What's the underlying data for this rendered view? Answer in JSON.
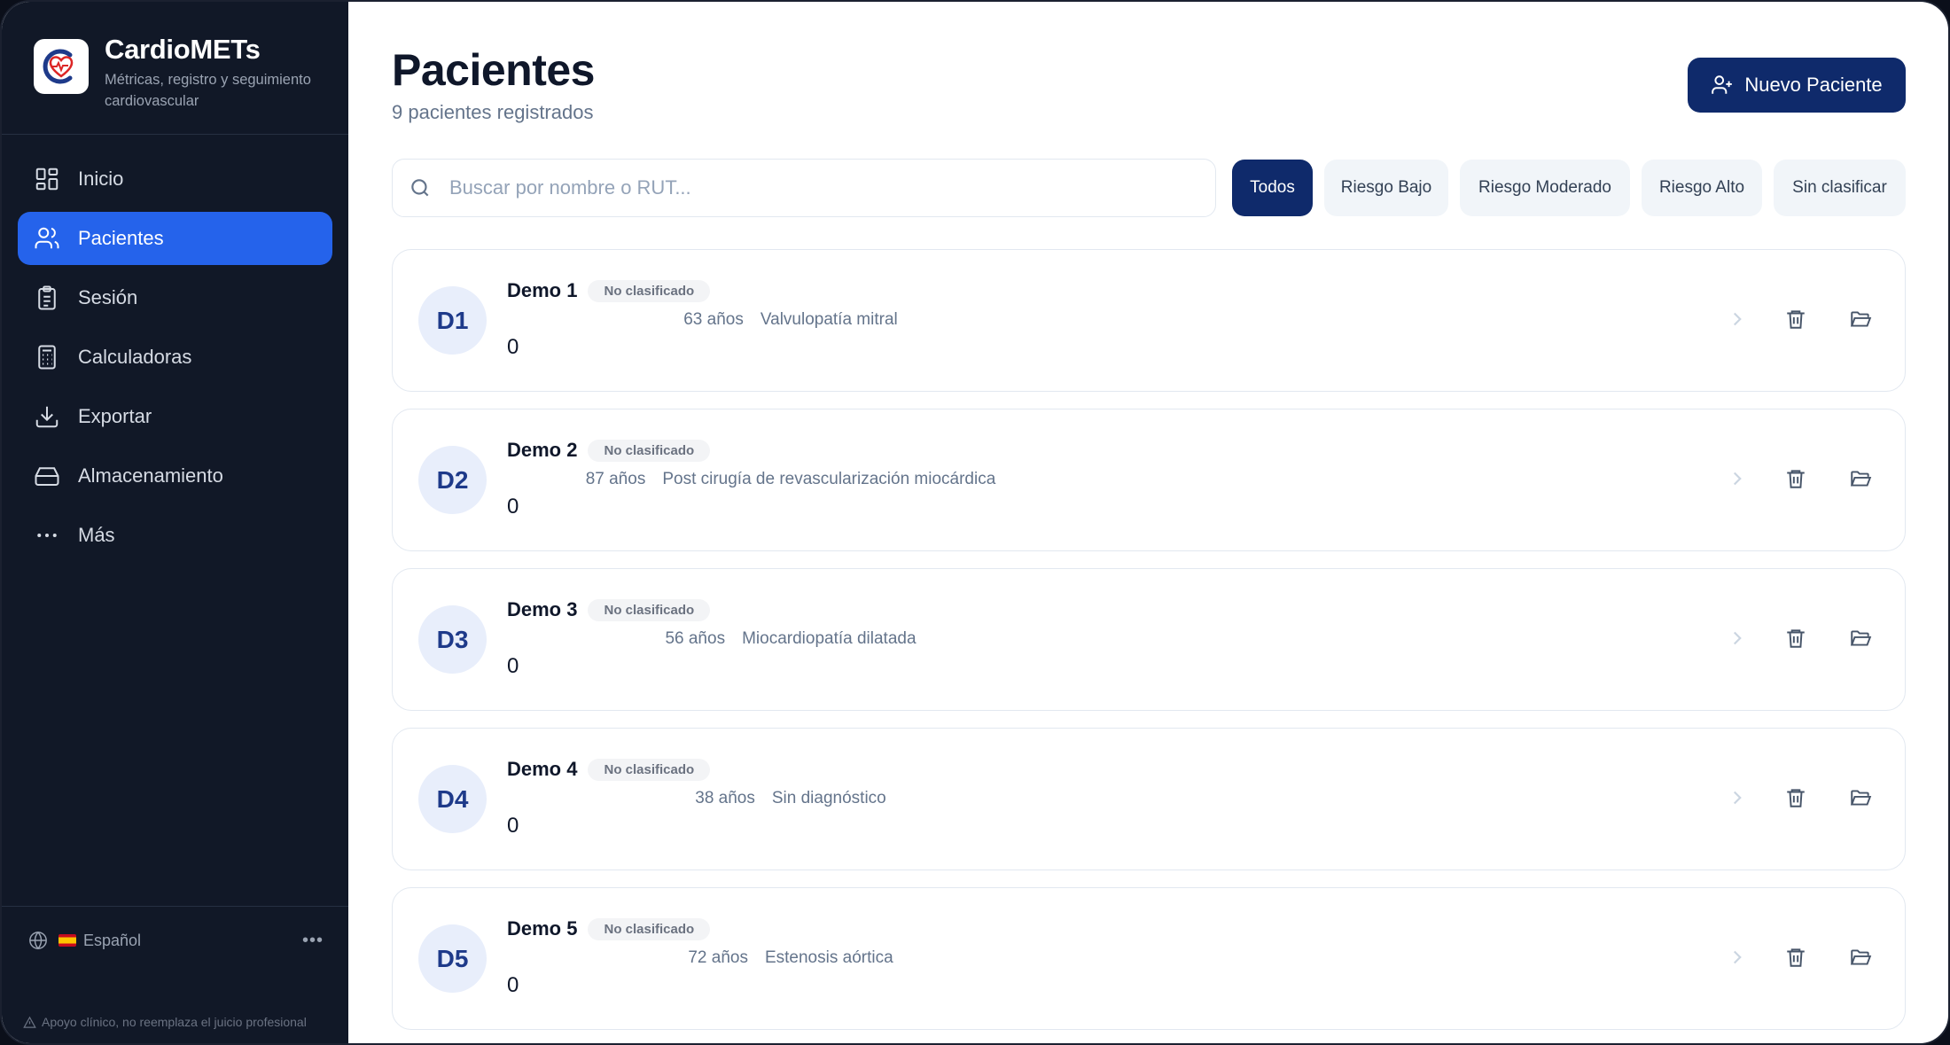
{
  "app": {
    "name": "CardioMETs",
    "tagline": "Métricas, registro y seguimiento cardiovascular"
  },
  "nav": [
    {
      "label": "Inicio",
      "icon": "grid-icon",
      "active": false
    },
    {
      "label": "Pacientes",
      "icon": "users-icon",
      "active": true
    },
    {
      "label": "Sesión",
      "icon": "clipboard-icon",
      "active": false
    },
    {
      "label": "Calculadoras",
      "icon": "calculator-icon",
      "active": false
    },
    {
      "label": "Exportar",
      "icon": "download-icon",
      "active": false
    },
    {
      "label": "Almacenamiento",
      "icon": "hard-drive-icon",
      "active": false
    },
    {
      "label": "Más",
      "icon": "more-horizontal-icon",
      "active": false
    }
  ],
  "footer": {
    "language": "Español",
    "disclaimer": "Apoyo clínico, no reemplaza el juicio profesional"
  },
  "page": {
    "title": "Pacientes",
    "subtitle": "9 pacientes registrados",
    "new_button": "Nuevo Paciente"
  },
  "search": {
    "placeholder": "Buscar por nombre o RUT...",
    "value": ""
  },
  "filters": [
    {
      "label": "Todos",
      "active": true
    },
    {
      "label": "Riesgo Bajo",
      "active": false
    },
    {
      "label": "Riesgo Moderado",
      "active": false
    },
    {
      "label": "Riesgo Alto",
      "active": false
    },
    {
      "label": "Sin clasificar",
      "active": false
    }
  ],
  "patients": [
    {
      "initials": "D1",
      "name": "Demo 1",
      "badge": "No clasificado",
      "age": "63 años",
      "diagnosis": "Valvulopatía mitral",
      "count": "0"
    },
    {
      "initials": "D2",
      "name": "Demo 2",
      "badge": "No clasificado",
      "age": "87 años",
      "diagnosis": "Post cirugía de revascularización miocárdica",
      "count": "0"
    },
    {
      "initials": "D3",
      "name": "Demo 3",
      "badge": "No clasificado",
      "age": "56 años",
      "diagnosis": "Miocardiopatía dilatada",
      "count": "0"
    },
    {
      "initials": "D4",
      "name": "Demo 4",
      "badge": "No clasificado",
      "age": "38 años",
      "diagnosis": "Sin diagnóstico",
      "count": "0"
    },
    {
      "initials": "D5",
      "name": "Demo 5",
      "badge": "No clasificado",
      "age": "72 años",
      "diagnosis": "Estenosis aórtica",
      "count": "0"
    }
  ],
  "colors": {
    "sidebar_bg": "#111827",
    "accent": "#2563eb",
    "primary_dark": "#0f2a6b",
    "avatar_bg": "#e8eefb"
  }
}
